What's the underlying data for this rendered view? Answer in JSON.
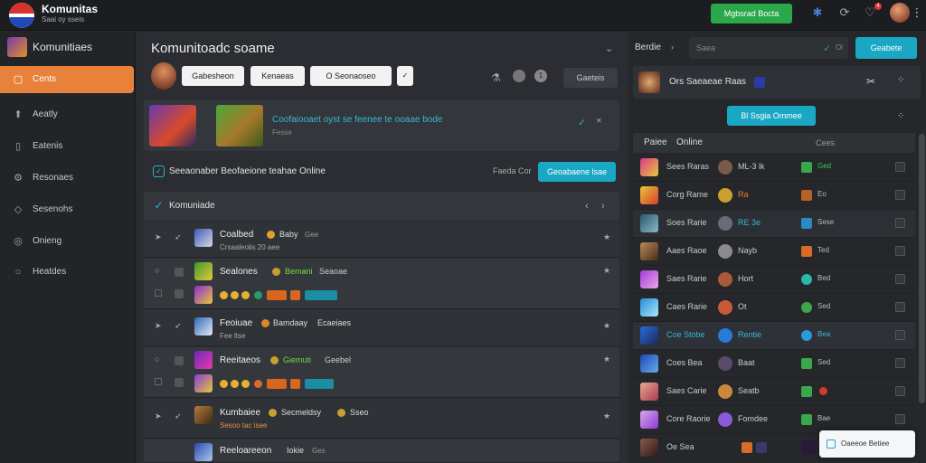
{
  "topbar": {
    "brand": "Komunitas",
    "brand_sub": "Saai oy sseis",
    "cta_label": "Mgbsrad Bocta",
    "icons": [
      "puzzle-icon",
      "refresh-icon",
      "bell-icon"
    ],
    "notif_count": "4"
  },
  "sidebar": {
    "title": "Komunitiaes",
    "items": [
      {
        "label": "Cents",
        "icon": "document-icon",
        "active": true
      },
      {
        "label": "Aeatly",
        "icon": "up-arrow-icon"
      },
      {
        "label": "Eatenis",
        "icon": "page-icon"
      },
      {
        "label": "Resonaes",
        "icon": "gear-icon"
      },
      {
        "label": "Sesenohs",
        "icon": "diamond-icon"
      },
      {
        "label": "Onieng",
        "icon": "circle-icon"
      },
      {
        "label": "Heatdes",
        "icon": "ring-icon"
      }
    ]
  },
  "main": {
    "title": "Komunitoadc soame",
    "pills": [
      "Gabesheon",
      "Kenaeas",
      "O Seonaoseo"
    ],
    "controls_label": "Gaeteis",
    "banner": {
      "title": "Coofaiooaet oyst  se feenee te ooaae bode",
      "sub": "Fesse"
    },
    "online_label": "Seeaonaber Beofaeione teahae Online",
    "online_side": "Faeda Cor",
    "online_btn": "Geoabaene lsae",
    "list_title": "Komuniade",
    "rows": [
      {
        "name": "Coalbed",
        "tag": "Baby",
        "extra": "Gee",
        "sub": "Crsaaleolis 20 aee"
      },
      {
        "name": "Sealones",
        "tag": "Bemani",
        "extra": "Seaoae",
        "sub": ""
      },
      {
        "name": "Feoiuae",
        "tag": "Bamdaay",
        "extra": "Ecaeiaes",
        "sub": "Fee ltse"
      },
      {
        "name": "Reeitaeos",
        "tag": "Giemuti",
        "extra": "Geebel",
        "sub": ""
      },
      {
        "name": "Kumbaiee",
        "tag": "Secmeldsy",
        "extra": "Sseo",
        "sub": "Sesoo tac isee"
      },
      {
        "name": "Reeloareeon",
        "tag": "Iokie",
        "extra": "Ges",
        "sub": ""
      }
    ]
  },
  "right": {
    "label": "Berdie",
    "search_placeholder": "Saea",
    "btn": "Geabete",
    "card_title": "Ors Saeaeae Raas",
    "center_btn": "Bl Ssgia Ommee",
    "table_head": {
      "c1": "Paiee",
      "c2": "Online",
      "c3": "Cees"
    },
    "rows": [
      {
        "name": "Sees Raras",
        "player": "ML-3 lk",
        "status": "Ged"
      },
      {
        "name": "Corg Rame",
        "player": "Ra",
        "status": "Eo"
      },
      {
        "name": "Soes Rarie",
        "player": "RE 3e",
        "status": "Sese"
      },
      {
        "name": "Aaes Raoe",
        "player": "Nayb",
        "status": "Ted"
      },
      {
        "name": "Saes Rarie",
        "player": "Hort",
        "status": "Bed"
      },
      {
        "name": "Caes Rarie",
        "player": "Ot",
        "status": "Sed"
      },
      {
        "name": "Coe Stobe",
        "player": "Rentie",
        "status": "Bea"
      },
      {
        "name": "Coes Bea",
        "player": "Baat",
        "status": "Sed"
      },
      {
        "name": "Saes Carie",
        "player": "Seatb",
        "status": ""
      },
      {
        "name": "Core Raorie",
        "player": "Fomdee",
        "status": "Bae"
      },
      {
        "name": "Oe Sea",
        "player": "",
        "status": ""
      }
    ],
    "toast": "Oaeeoe Betiee"
  }
}
